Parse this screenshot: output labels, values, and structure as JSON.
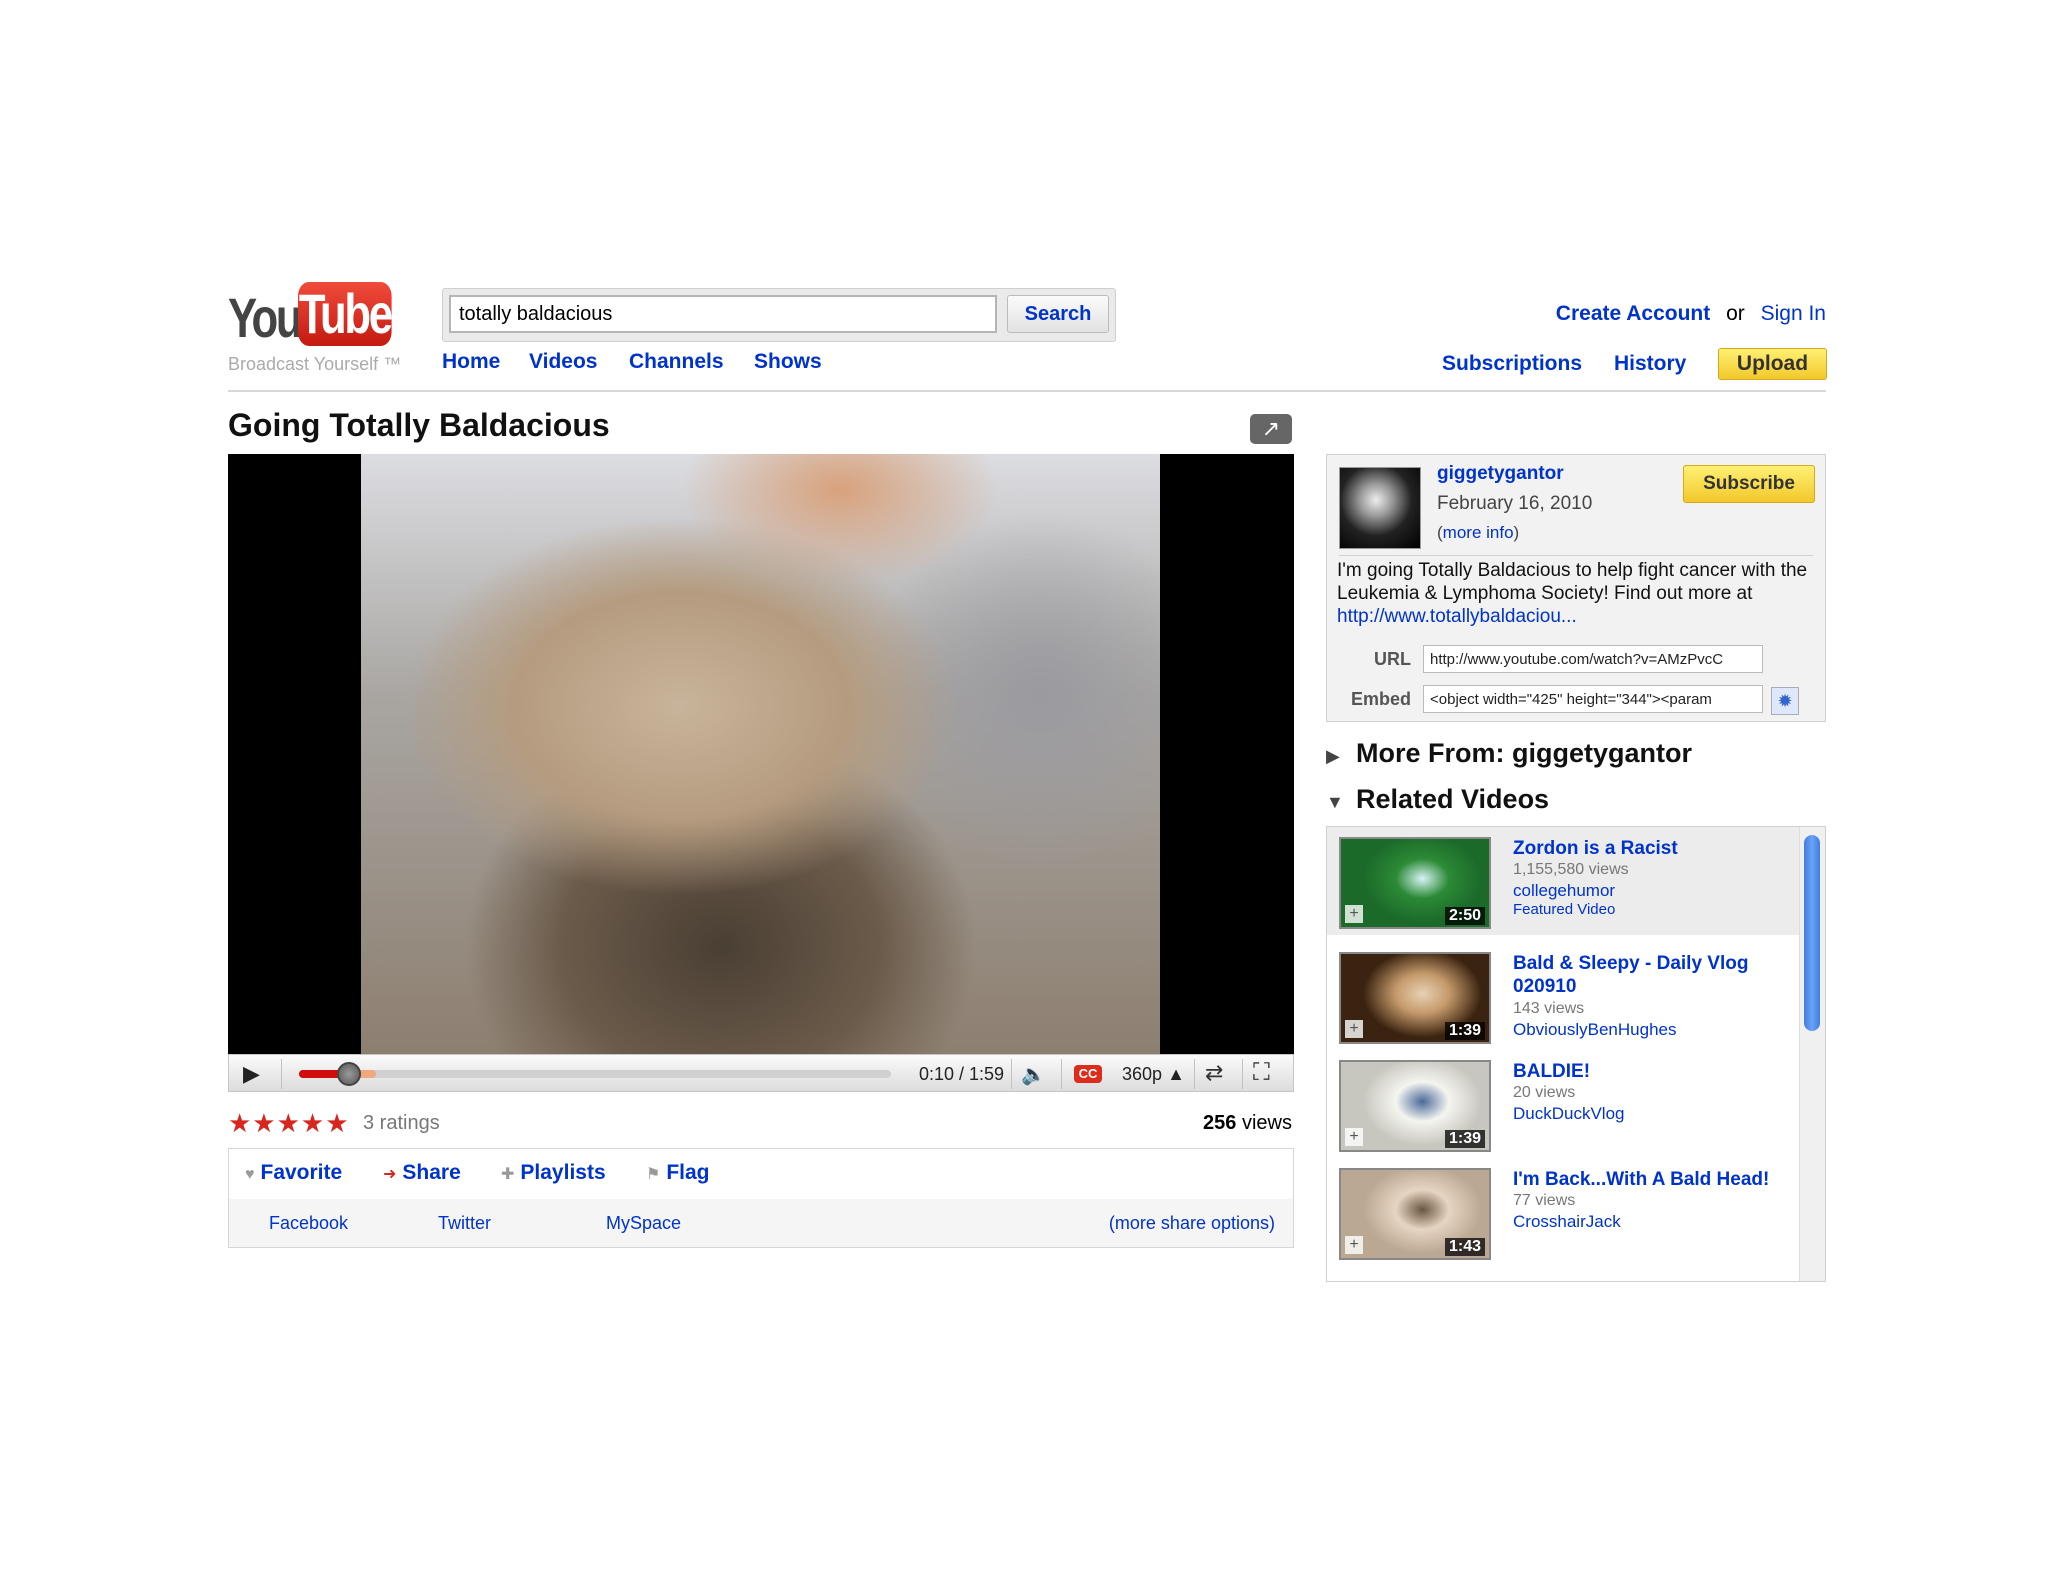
{
  "header": {
    "logo_you": "You",
    "logo_tube": "Tube",
    "logo_tagline": "Broadcast Yourself ™",
    "search_value": "totally baldacious",
    "search_button": "Search",
    "nav": [
      "Home",
      "Videos",
      "Channels",
      "Shows"
    ],
    "create_account": "Create Account",
    "or": "or",
    "sign_in": "Sign In",
    "subscriptions": "Subscriptions",
    "history": "History",
    "upload": "Upload"
  },
  "video": {
    "title": "Going Totally Baldacious",
    "current_time": "0:10",
    "duration": "1:59",
    "time_display": "0:10 / 1:59",
    "progress_fraction": 0.084,
    "buffered_fraction": 0.13,
    "quality": "360p",
    "cc_label": "CC",
    "ratings": "3 ratings",
    "views_number": "256",
    "views_label": "views"
  },
  "actions": {
    "tabs": [
      "Favorite",
      "Share",
      "Playlists",
      "Flag"
    ],
    "share_links": [
      "Facebook",
      "Twitter",
      "MySpace"
    ],
    "more_share": "(more share options)"
  },
  "channel": {
    "name": "giggetygantor",
    "date": "February 16, 2010",
    "more_info_open": "(",
    "more_info": "more info",
    "more_info_close": ")",
    "subscribe": "Subscribe",
    "description": "I'm going Totally Baldacious to help fight cancer with the Leukemia & Lymphoma Society! Find out more at ",
    "description_link": "http://www.totallybaldaciou...",
    "url_label": "URL",
    "url_value": "http://www.youtube.com/watch?v=AMzPvcC",
    "embed_label": "Embed",
    "embed_value": "<object width=\"425\" height=\"344\"><param"
  },
  "sidebar": {
    "more_from": "More From: giggetygantor",
    "related_heading": "Related Videos",
    "related": [
      {
        "title": "Zordon is a Racist",
        "views": "1,155,580 views",
        "user": "collegehumor",
        "featured": "Featured Video",
        "duration": "2:50",
        "colors": [
          "#1b6a2a",
          "#2c8a36",
          "#d7f3f5"
        ]
      },
      {
        "title": "Bald & Sleepy - Daily Vlog 020910",
        "views": "143 views",
        "user": "ObviouslyBenHughes",
        "featured": "",
        "duration": "1:39",
        "colors": [
          "#3a2310",
          "#c59a6b",
          "#e7d1b4"
        ]
      },
      {
        "title": "BALDIE!",
        "views": "20 views",
        "user": "DuckDuckVlog",
        "featured": "",
        "duration": "1:39",
        "colors": [
          "#c8c7bf",
          "#f5f5f0",
          "#4a6a9a"
        ]
      },
      {
        "title": "I'm Back...With A Bald Head!",
        "views": "77 views",
        "user": "CrosshairJack",
        "featured": "",
        "duration": "1:43",
        "colors": [
          "#bba893",
          "#e6d5c2",
          "#6a5540"
        ]
      }
    ]
  }
}
